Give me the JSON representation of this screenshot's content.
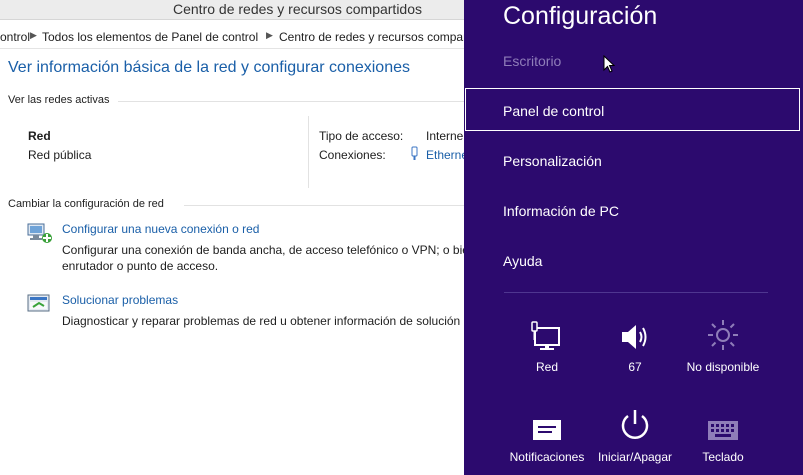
{
  "window": {
    "title": "Centro de redes y recursos compartidos",
    "breadcrumb": [
      "ontrol",
      "Todos los elementos de Panel de control",
      "Centro de redes y recursos compartidos"
    ],
    "heading": "Ver información básica de la red y configurar conexiones",
    "active_networks": {
      "label": "Ver las redes activas",
      "network_name": "Red",
      "network_type": "Red pública",
      "access_type_label": "Tipo de acceso:",
      "access_type_value": "Interne",
      "connections_label": "Conexiones:",
      "connections_value": "Etherne"
    },
    "change_settings": {
      "label": "Cambiar la configuración de red",
      "tasks": [
        {
          "title": "Configurar una nueva conexión o red",
          "desc_line1": "Configurar una conexión de banda ancha, de acceso telefónico o VPN; o bie",
          "desc_line2": "enrutador o punto de acceso.",
          "icon": "new-connection-icon"
        },
        {
          "title": "Solucionar problemas",
          "desc_line1": "Diagnosticar y reparar problemas de red u obtener información de solución d",
          "icon": "troubleshoot-icon"
        }
      ]
    }
  },
  "charm": {
    "title": "Configuración",
    "items": [
      "Escritorio",
      "Panel de control",
      "Personalización",
      "Información de PC",
      "Ayuda"
    ],
    "selected_index": 1,
    "tiles_row1": [
      {
        "label": "Red",
        "icon": "network-monitor-icon"
      },
      {
        "label": "67",
        "icon": "volume-icon"
      },
      {
        "label": "No disponible",
        "icon": "brightness-icon"
      }
    ],
    "tiles_row2": [
      {
        "label": "Notificaciones",
        "icon": "notifications-icon"
      },
      {
        "label": "Iniciar/Apagar",
        "icon": "power-icon"
      },
      {
        "label": "Teclado",
        "icon": "keyboard-icon"
      }
    ],
    "colors": {
      "background": "#2c0a6e",
      "disabled_text": "#8f7db9"
    }
  }
}
